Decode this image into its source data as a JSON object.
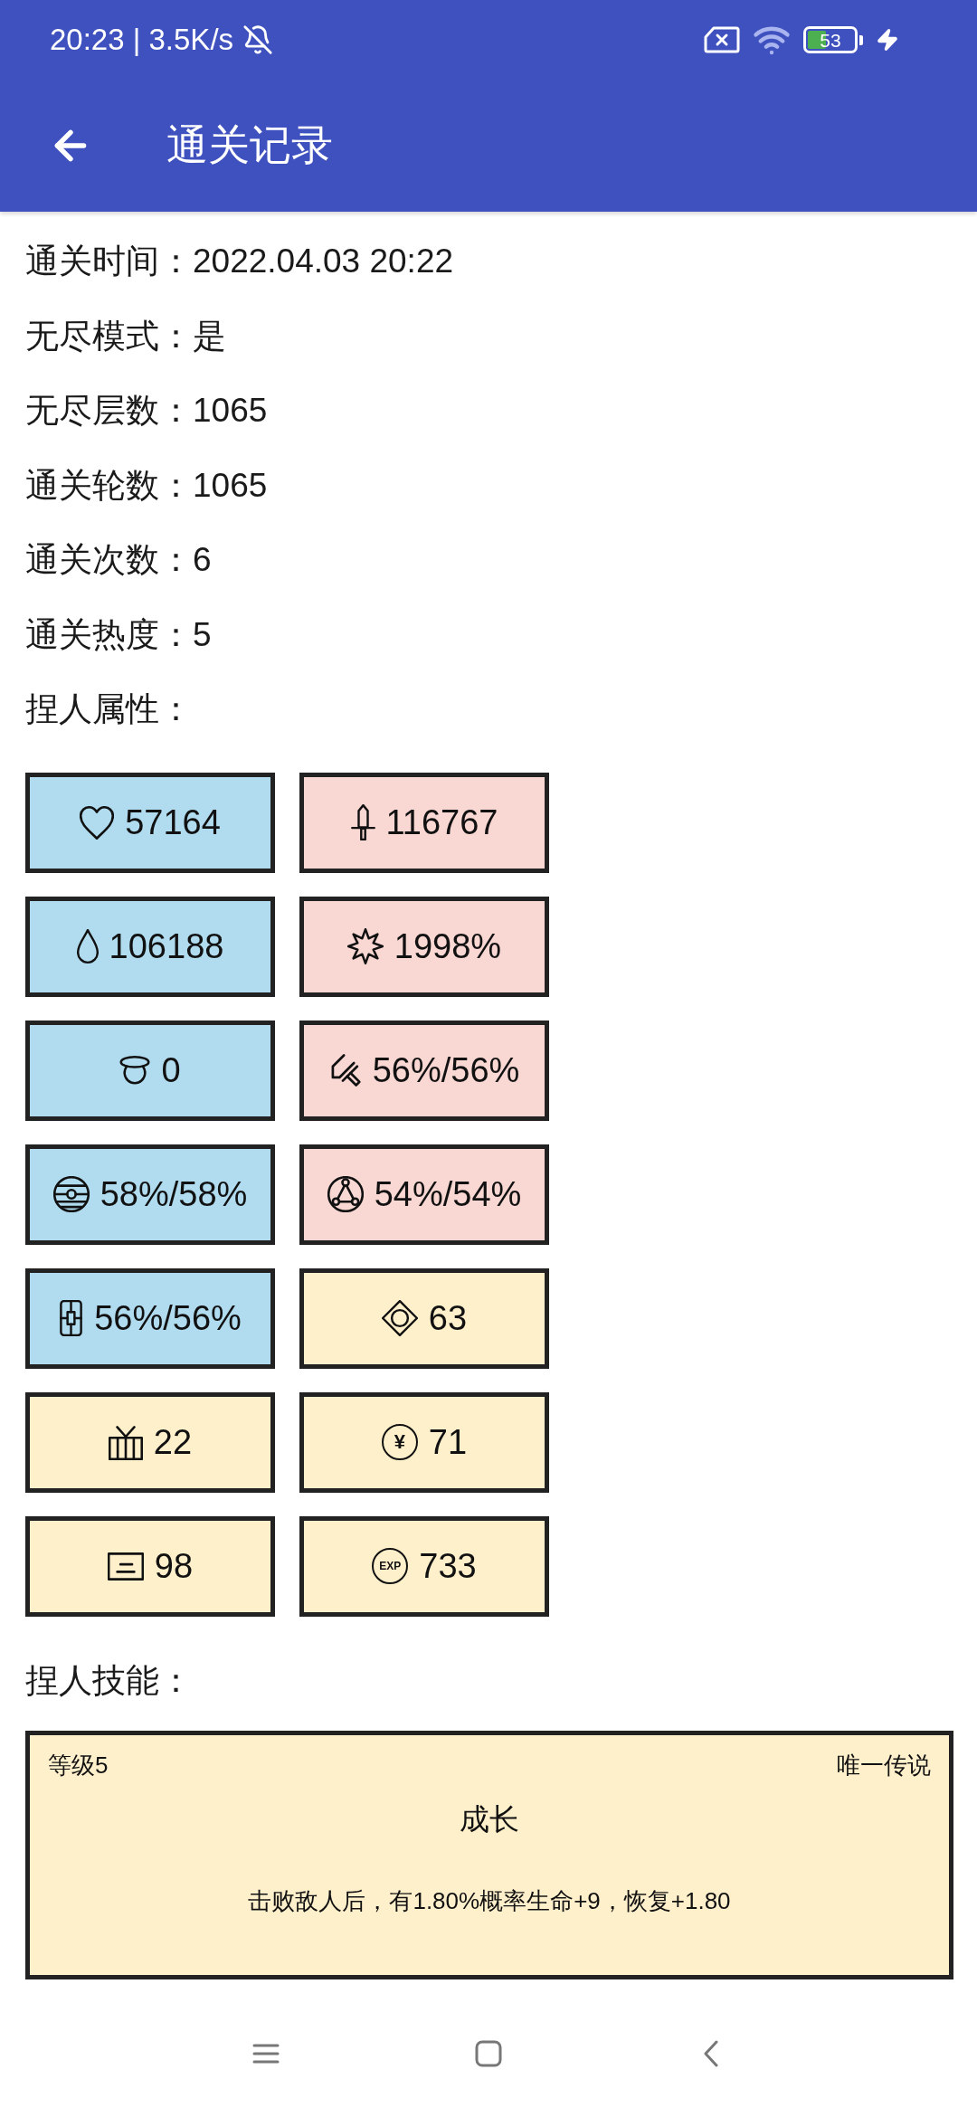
{
  "status_bar": {
    "text": "20:23 | 3.5K/s",
    "battery": "53"
  },
  "app_bar": {
    "title": "通关记录"
  },
  "record_lines": [
    "通关时间：2022.04.03 20:22",
    "无尽模式：是",
    "无尽层数：1065",
    "通关轮数：1065",
    "通关次数：6",
    "通关热度：5"
  ],
  "attributes": {
    "heading": "捏人属性：",
    "stats": [
      {
        "value": "57164",
        "color": "#b1dcf0"
      },
      {
        "value": "116767",
        "color": "#f9d7d3"
      },
      {
        "value": "106188",
        "color": "#b1dcf0"
      },
      {
        "value": "1998%",
        "color": "#f9d7d3"
      },
      {
        "value": "0",
        "color": "#b1dcf0"
      },
      {
        "value": "56%/56%",
        "color": "#f9d7d3"
      },
      {
        "value": "58%/58%",
        "color": "#b1dcf0"
      },
      {
        "value": "54%/54%",
        "color": "#f9d7d3"
      },
      {
        "value": "56%/56%",
        "color": "#b1dcf0"
      },
      {
        "value": "63",
        "color": "#fff0cc"
      },
      {
        "value": "22",
        "color": "#fff0cc"
      },
      {
        "value": "71",
        "color": "#fff0cc",
        "icon_text": "¥"
      },
      {
        "value": "98",
        "color": "#fff0cc"
      },
      {
        "value": "733",
        "color": "#fff0cc",
        "icon_text": "EXP"
      }
    ]
  },
  "skills": {
    "heading": "捏人技能：",
    "cards": [
      {
        "level": "等级5",
        "rarity": "唯一传说",
        "name": "成长",
        "description": "击败敌人后，有1.80%概率生命+9，恢复+1.80"
      }
    ]
  }
}
